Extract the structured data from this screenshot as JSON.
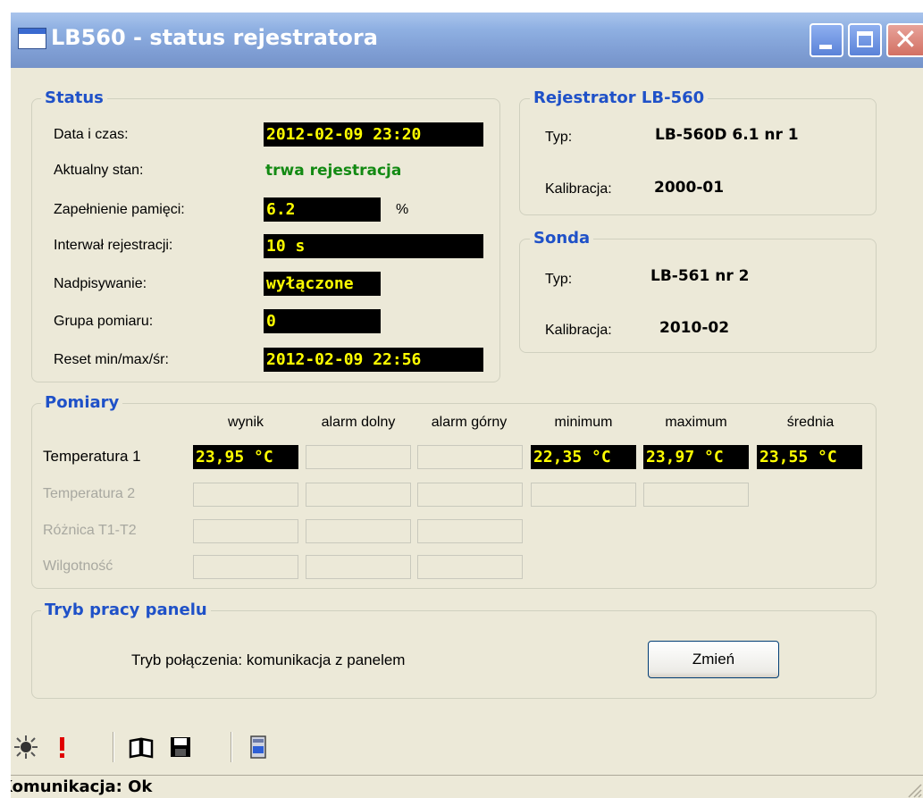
{
  "window": {
    "title": "LB560 - status rejestratora"
  },
  "status": {
    "title": "Status",
    "rows": [
      {
        "label": "Data i czas:",
        "value": "2012-02-09 23:20"
      },
      {
        "label": "Aktualny stan:",
        "value": "trwa rejestracja"
      },
      {
        "label": "Zapełnienie pamięci:",
        "value": "6.2",
        "unit": "%"
      },
      {
        "label": "Interwał rejestracji:",
        "value": "10 s"
      },
      {
        "label": "Nadpisywanie:",
        "value": "wyłączone"
      },
      {
        "label": "Grupa pomiaru:",
        "value": "0"
      },
      {
        "label": "Reset min/max/śr:",
        "value": "2012-02-09 22:56"
      }
    ]
  },
  "rejestrator": {
    "title": "Rejestrator LB-560",
    "typ_label": "Typ:",
    "typ_value": "LB-560D 6.1 nr 1",
    "kal_label": "Kalibracja:",
    "kal_value": "2000-01"
  },
  "sonda": {
    "title": "Sonda",
    "typ_label": "Typ:",
    "typ_value": "LB-561 nr 2",
    "kal_label": "Kalibracja:",
    "kal_value": "2010-02"
  },
  "pomiary": {
    "title": "Pomiary",
    "columns": [
      "wynik",
      "alarm dolny",
      "alarm górny",
      "minimum",
      "maximum",
      "średnia"
    ],
    "rows": [
      {
        "label": "Temperatura 1",
        "values": [
          "23,95 °C",
          "",
          "",
          "22,35 °C",
          "23,97 °C",
          "23,55 °C"
        ]
      },
      {
        "label": "Temperatura 2"
      },
      {
        "label": "Różnica T1-T2"
      },
      {
        "label": "Wilgotność"
      }
    ]
  },
  "panel": {
    "title": "Tryb pracy panelu",
    "mode_text": "Tryb połączenia: komunikacja z panelem",
    "change_button": "Zmień"
  },
  "toolbar": {
    "icons": [
      "sun-icon",
      "alert-icon",
      "book-icon",
      "save-icon",
      "device-icon"
    ]
  },
  "statusbar": {
    "text": "Komunikacja: Ok"
  },
  "colors": {
    "value_bg": "#000000",
    "value_fg": "#ffff00",
    "group_title": "#1f51c8",
    "status_green": "#138a13"
  }
}
